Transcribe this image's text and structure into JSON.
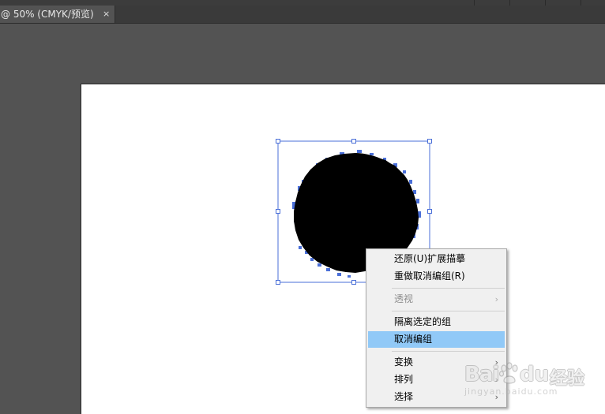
{
  "document_tab": {
    "title": "@ 50% (CMYK/预览)",
    "close_glyph": "×"
  },
  "canvas": {
    "background_color": "#535353",
    "artboard_color": "#ffffff",
    "selection_color": "#4a6fd8",
    "shape_fill": "#000000"
  },
  "context_menu": {
    "items": [
      {
        "label": "还原(U)扩展描摹",
        "enabled": true,
        "submenu": false
      },
      {
        "label": "重做取消编组(R)",
        "enabled": true,
        "submenu": false
      },
      {
        "label": "透视",
        "enabled": false,
        "submenu": true,
        "arrow": "›"
      },
      {
        "label": "隔离选定的组",
        "enabled": true,
        "submenu": false
      },
      {
        "label": "取消编组",
        "enabled": true,
        "submenu": false,
        "highlighted": true
      },
      {
        "label": "变换",
        "enabled": true,
        "submenu": true,
        "arrow": "›"
      },
      {
        "label": "排列",
        "enabled": true,
        "submenu": true,
        "arrow": "›"
      },
      {
        "label": "选择",
        "enabled": true,
        "submenu": true,
        "arrow": "›"
      }
    ],
    "highlight_color": "#91c9f7"
  },
  "watermark": {
    "brand_bai": "Bai",
    "brand_du": "du",
    "brand_jingyan": "经验",
    "url": "jingyan.baidu.com"
  }
}
